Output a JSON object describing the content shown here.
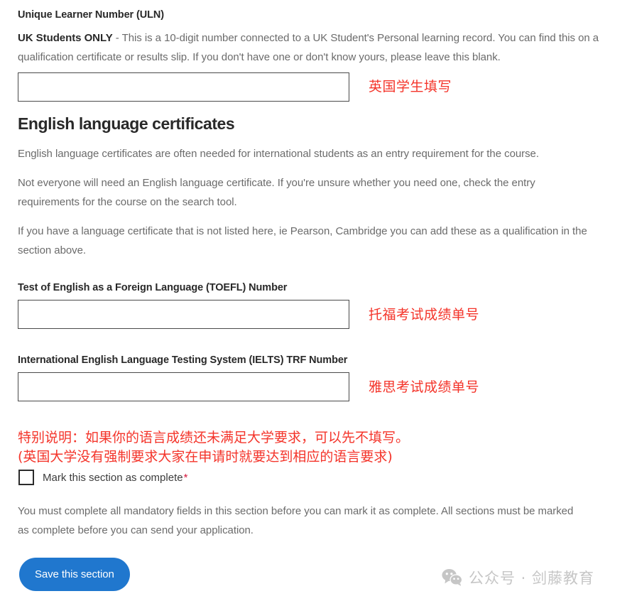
{
  "uln": {
    "heading": "Unique Learner Number (ULN)",
    "description_bold": "UK Students ONLY",
    "description_rest": " - This is a 10-digit number connected to a UK Student's Personal learning record. You can find this on a qualification certificate or results slip. If you don't have one or don't know yours, please leave this blank.",
    "input_value": "",
    "input_placeholder": "",
    "annotation": "英国学生填写"
  },
  "english_section": {
    "heading": "English language certificates",
    "paragraph_1": "English language certificates are often needed for international students as an entry requirement for the course.",
    "paragraph_2": "Not everyone will need an English language certificate. If you're unsure whether you need one, check the entry requirements for the course on the search tool.",
    "paragraph_3": "If you have a language certificate that is not listed here, ie Pearson, Cambridge you can add these as a qualification in the section above."
  },
  "toefl": {
    "label": "Test of English as a Foreign Language (TOEFL) Number",
    "input_value": "",
    "input_placeholder": "",
    "annotation": "托福考试成绩单号"
  },
  "ielts": {
    "label": "International English Language Testing System (IELTS) TRF Number",
    "input_value": "",
    "input_placeholder": "",
    "annotation": "雅思考试成绩单号"
  },
  "red_note": {
    "line_1": "特别说明：如果你的语言成绩还未满足大学要求，可以先不填写。",
    "line_2": "(英国大学没有强制要求大家在申请时就要达到相应的语言要求)"
  },
  "complete_checkbox": {
    "label": "Mark this section as complete",
    "required_marker": "*",
    "checked": false
  },
  "mandatory_note": "You must complete all mandatory fields in this section before you can mark it as complete. All sections must be marked as complete before you can send your application.",
  "save_button": {
    "label": "Save this section"
  },
  "watermark": {
    "icon": "wechat-icon",
    "text": "公众号 · 剑藤教育"
  },
  "colors": {
    "annotation_red": "#f4342a",
    "button_blue": "#2077ce",
    "required_star": "#d4183c",
    "body_gray": "#6b6b6b",
    "heading_dark": "#292929",
    "watermark_gray": "#c6c6c6"
  }
}
